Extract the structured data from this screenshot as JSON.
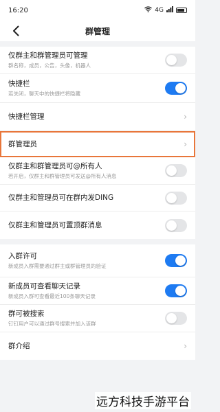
{
  "status": {
    "time": "16:20",
    "signal": "4G",
    "battery": ""
  },
  "header": {
    "title": "群管理"
  },
  "sections": [
    {
      "rows": [
        {
          "title": "仅群主和群管理员可管理",
          "sub": "群名称，成员，公告，头像，机器人",
          "control": "toggle",
          "on": false
        },
        {
          "title": "快捷栏",
          "sub": "若关闭，聊天中的快捷栏将隐藏",
          "control": "toggle",
          "on": true
        },
        {
          "title": "快捷栏管理",
          "sub": "",
          "control": "chevron"
        },
        {
          "title": "群管理员",
          "sub": "",
          "control": "chevron",
          "highlight": true
        },
        {
          "title": "仅群主和群管理员可@所有人",
          "sub": "若开启，仅群主和群管理员可发送@所有人消息",
          "control": "toggle",
          "on": false
        },
        {
          "title": "仅群主和管理员可在群内发DING",
          "sub": "",
          "control": "toggle",
          "on": false
        },
        {
          "title": "仅群主和管理员可置顶群消息",
          "sub": "",
          "control": "toggle",
          "on": false
        }
      ]
    },
    {
      "rows": [
        {
          "title": "入群许可",
          "sub": "新成员入群需要通过群主或群管理员的验证",
          "control": "toggle",
          "on": true
        },
        {
          "title": "新成员可查看聊天记录",
          "sub": "新成员入群可查看最近100条聊天记录",
          "control": "toggle",
          "on": true
        },
        {
          "title": "群可被搜索",
          "sub": "钉钉用户可以通过群号搜索并加入该群",
          "control": "toggle",
          "on": false
        },
        {
          "title": "群介绍",
          "sub": "",
          "control": "chevron"
        }
      ]
    }
  ],
  "watermark": "远方科技手游平台",
  "colors": {
    "accent": "#1e7bf2",
    "highlight": "#e8763a"
  }
}
